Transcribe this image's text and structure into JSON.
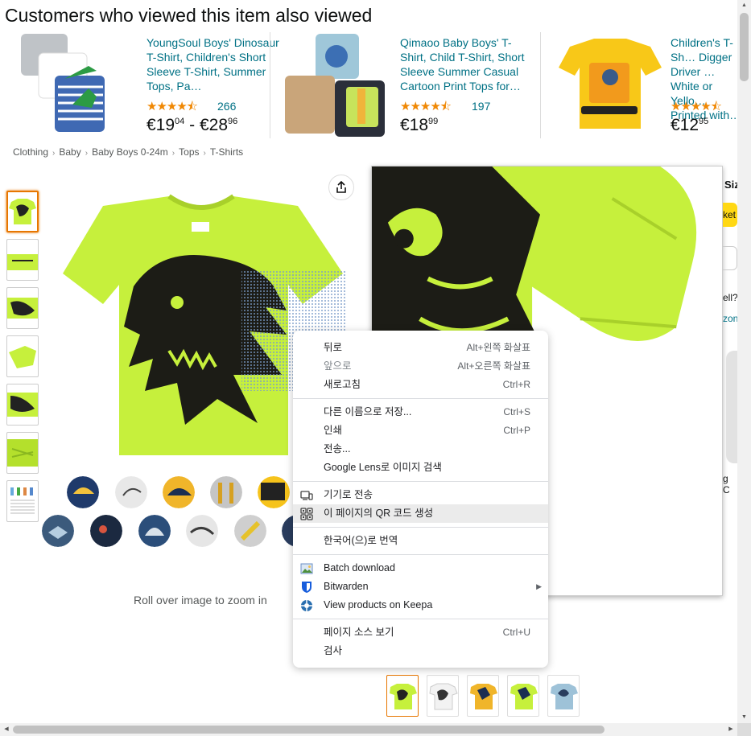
{
  "section_title": "Customers who viewed this item also viewed",
  "products": [
    {
      "title": "YoungSoul Boys' Dinosaur T-Shirt, Children's Short Sleeve T-Shirt, Summer Tops, Pa…",
      "stars": "★★★★⯪",
      "reviews": "266",
      "price_a_whole": "€19",
      "price_a_frac": "04",
      "price_sep": " - ",
      "price_b_whole": "€28",
      "price_b_frac": "96"
    },
    {
      "title": "Qimaoo Baby Boys' T-Shirt, Child T-Shirt, Short Sleeve Summer Casual Cartoon Print Tops for…",
      "stars": "★★★★⯪",
      "reviews": "197",
      "price_a_whole": "€18",
      "price_a_frac": "99"
    },
    {
      "title": "Children's T-Sh… Digger Driver … White or Yello… Printed with…",
      "stars": "★★★★⯪",
      "price_a_whole": "€12",
      "price_a_frac": "95"
    }
  ],
  "breadcrumb": [
    "Clothing",
    "Baby",
    "Baby Boys 0-24m",
    "Tops",
    "T-Shirts"
  ],
  "zoom_hint": "Roll over image to zoom in",
  "right_peek": [
    "Siz",
    "ket",
    "ell?",
    "zon",
    "g C"
  ],
  "context_menu": {
    "items": [
      {
        "label": "뒤로",
        "shortcut": "Alt+왼쪽 화살표"
      },
      {
        "label": "앞으로",
        "shortcut": "Alt+오른쪽 화살표",
        "disabled": true
      },
      {
        "label": "새로고침",
        "shortcut": "Ctrl+R"
      },
      {
        "label": "다른 이름으로 저장...",
        "shortcut": "Ctrl+S"
      },
      {
        "label": "인쇄",
        "shortcut": "Ctrl+P"
      },
      {
        "label": "전송...",
        "shortcut": ""
      },
      {
        "label": "Google Lens로 이미지 검색",
        "shortcut": ""
      },
      {
        "label": "기기로 전송",
        "shortcut": ""
      },
      {
        "label": "이 페이지의 QR 코드 생성",
        "shortcut": ""
      },
      {
        "label": "한국어(으)로 번역",
        "shortcut": ""
      },
      {
        "label": "Batch download",
        "shortcut": ""
      },
      {
        "label": "Bitwarden",
        "shortcut": ""
      },
      {
        "label": "View products on Keepa",
        "shortcut": ""
      },
      {
        "label": "페이지 소스 보기",
        "shortcut": "Ctrl+U"
      },
      {
        "label": "검사",
        "shortcut": ""
      }
    ]
  },
  "colors": {
    "link": "#007185",
    "star": "#f08804",
    "accent": "#e77600",
    "shirt": "#c6f03c"
  }
}
